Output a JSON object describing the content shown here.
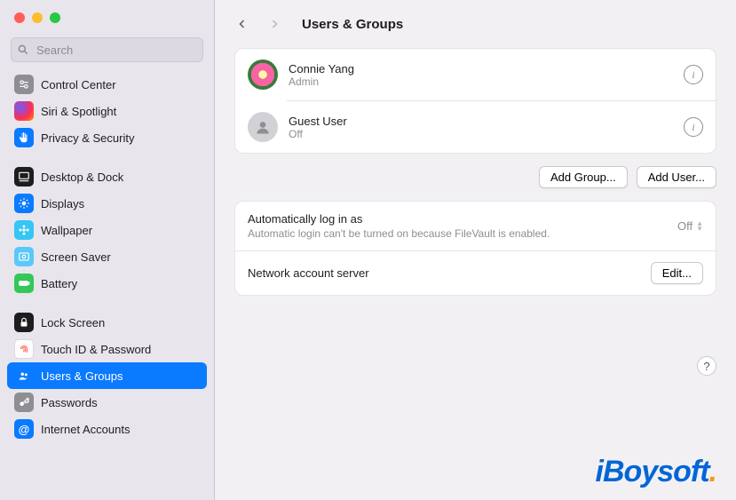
{
  "window": {
    "title": "Users & Groups",
    "search_placeholder": "Search"
  },
  "sidebar": {
    "items": [
      {
        "id": "control-center",
        "label": "Control Center",
        "icon": "control-center-icon"
      },
      {
        "id": "siri-spotlight",
        "label": "Siri & Spotlight",
        "icon": "siri-icon"
      },
      {
        "id": "privacy-security",
        "label": "Privacy & Security",
        "icon": "hand-icon"
      },
      {
        "id": "desktop-dock",
        "label": "Desktop & Dock",
        "icon": "desktop-icon"
      },
      {
        "id": "displays",
        "label": "Displays",
        "icon": "sun-icon"
      },
      {
        "id": "wallpaper",
        "label": "Wallpaper",
        "icon": "flower-icon"
      },
      {
        "id": "screensaver",
        "label": "Screen Saver",
        "icon": "screensaver-icon"
      },
      {
        "id": "battery",
        "label": "Battery",
        "icon": "battery-icon"
      },
      {
        "id": "lock-screen",
        "label": "Lock Screen",
        "icon": "lock-icon"
      },
      {
        "id": "touch-id",
        "label": "Touch ID & Password",
        "icon": "fingerprint-icon"
      },
      {
        "id": "users-groups",
        "label": "Users & Groups",
        "icon": "people-icon",
        "selected": true
      },
      {
        "id": "passwords",
        "label": "Passwords",
        "icon": "key-icon"
      },
      {
        "id": "internet-accounts",
        "label": "Internet Accounts",
        "icon": "at-icon"
      }
    ]
  },
  "users": [
    {
      "name": "Connie Yang",
      "role": "Admin",
      "avatar": "flower"
    },
    {
      "name": "Guest User",
      "role": "Off",
      "avatar": "silhouette"
    }
  ],
  "buttons": {
    "add_group": "Add Group...",
    "add_user": "Add User...",
    "edit": "Edit..."
  },
  "settings": {
    "auto_login_label": "Automatically log in as",
    "auto_login_value": "Off",
    "auto_login_sub": "Automatic login can't be turned on because FileVault is enabled.",
    "network_server_label": "Network account server"
  },
  "help_label": "?",
  "watermark": "iBoysoft"
}
